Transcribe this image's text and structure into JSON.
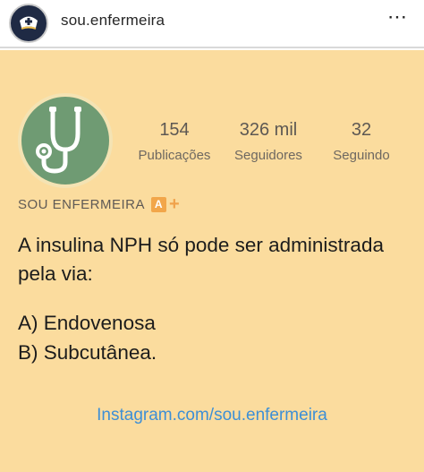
{
  "header": {
    "username": "sou.enfermeira",
    "more_label": "⋯"
  },
  "profile": {
    "stats": [
      {
        "value": "154",
        "label": "Publicações"
      },
      {
        "value": "326 mil",
        "label": "Seguidores"
      },
      {
        "value": "32",
        "label": "Seguindo"
      }
    ],
    "brand": "SOU ENFERMEIRA",
    "brand_badge": "A",
    "brand_plus": "+"
  },
  "post": {
    "question": "A insulina NPH só pode ser administrada pela via:",
    "options": [
      "A) Endovenosa",
      "B) Subcutânea."
    ],
    "link": "Instagram.com/sou.enfermeira"
  },
  "colors": {
    "card_bg": "#fbdc9e",
    "avatar_bg": "#6f9b73",
    "link": "#3d8fd6",
    "badge": "#f2a64a"
  },
  "icons": {
    "header_avatar": "nurse-cap-icon",
    "profile_avatar": "stethoscope-icon"
  }
}
